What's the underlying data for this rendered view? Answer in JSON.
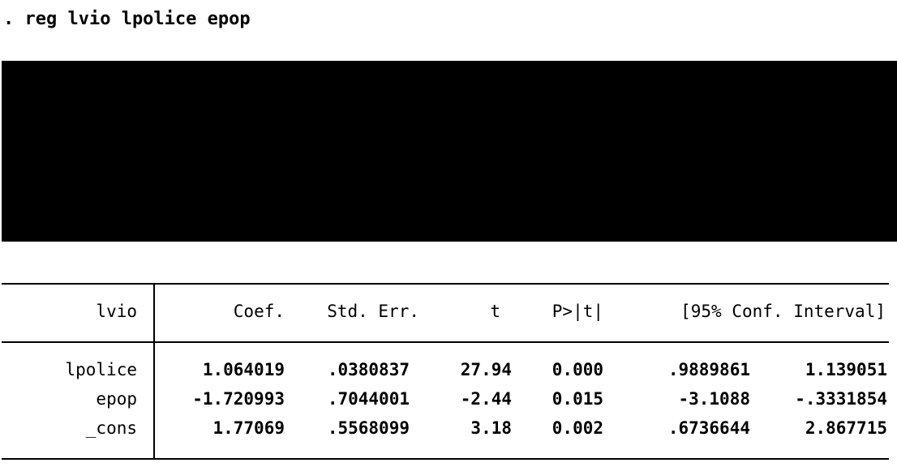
{
  "command": ". reg lvio lpolice epop",
  "table": {
    "depvar": "lvio",
    "headers": {
      "coef": "Coef.",
      "se": "Std. Err.",
      "t": "t",
      "p": "P>|t|",
      "ci": "[95% Conf. Interval]"
    },
    "rows": [
      {
        "name": "lpolice",
        "coef": "1.064019",
        "se": ".0380837",
        "t": "27.94",
        "p": "0.000",
        "ci_low": ".9889861",
        "ci_high": "1.139051"
      },
      {
        "name": "epop",
        "coef": "-1.720993",
        "se": ".7044001",
        "t": "-2.44",
        "p": "0.015",
        "ci_low": "-3.1088",
        "ci_high": "-.3331854"
      },
      {
        "name": "_cons",
        "coef": "1.77069",
        "se": ".5568099",
        "t": "3.18",
        "p": "0.002",
        "ci_low": ".6736644",
        "ci_high": "2.867715"
      }
    ]
  }
}
